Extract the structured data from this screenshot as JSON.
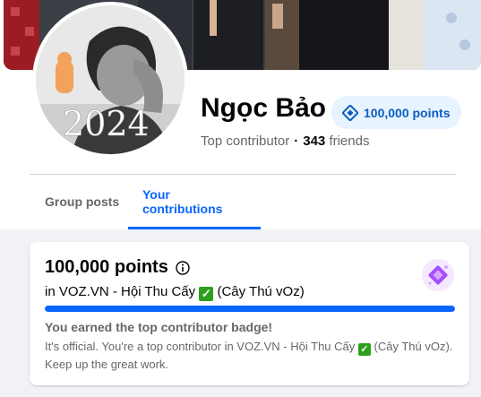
{
  "profile": {
    "name": "Ngọc Bảo",
    "points_badge": "100,000 points",
    "role": "Top contributor",
    "separator": "·",
    "friends_count": "343",
    "friends_label": "friends",
    "avatar_year_text": "2024"
  },
  "tabs": [
    {
      "label": "Group posts"
    },
    {
      "label": "Your contributions",
      "active": true
    }
  ],
  "card": {
    "title": "100,000 points",
    "group_prefix": "in",
    "group_name": "VOZ.VN - Hội Thu Cấy",
    "group_suffix": "(Cây Thú vOz)",
    "check_glyph": "✓",
    "progress_percent": 100,
    "earned_title": "You earned the top contributor badge!",
    "earned_desc_1": "It's official. You're a top contributor in VOZ.VN - Hội Thu Cấy",
    "earned_desc_2": "(Cây Thú vOz). Keep up the great work."
  },
  "colors": {
    "accent": "#0866ff",
    "badge_bg": "#e7f3ff",
    "badge_text": "#0a5dc2",
    "check": "#2ca01c",
    "muted": "#65676b"
  }
}
